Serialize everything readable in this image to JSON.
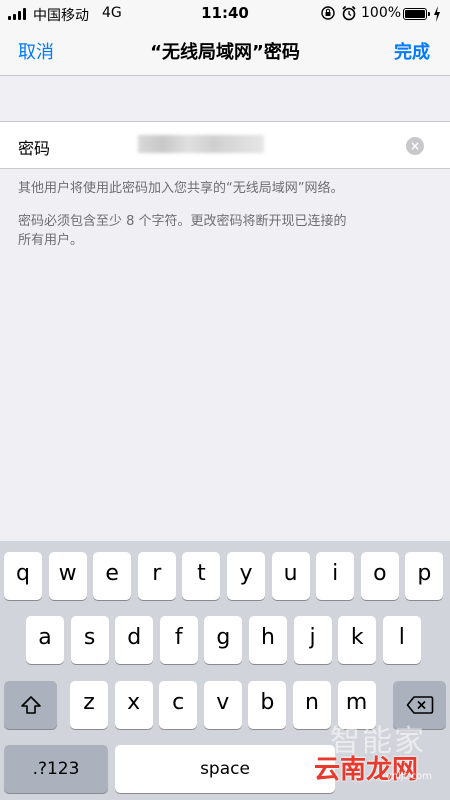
{
  "status_bar": {
    "carrier": "中国移动",
    "network": "4G",
    "time": "11:40",
    "battery_percent": "100%"
  },
  "nav": {
    "cancel_label": "取消",
    "title": "“无线局域网”密码",
    "done_label": "完成"
  },
  "form": {
    "password_label": "密码",
    "password_value": "********",
    "clear_icon": "×"
  },
  "footer": {
    "line1": "其他用户将使用此密码加入您共享的“无线局域网”网络。",
    "line2a": "密码必须包含至少 8 个字符。更改密码将断开现已连接的",
    "line2b": "所有用户。"
  },
  "keyboard": {
    "row1": [
      "q",
      "w",
      "e",
      "r",
      "t",
      "y",
      "u",
      "i",
      "o",
      "p"
    ],
    "row2": [
      "a",
      "s",
      "d",
      "f",
      "g",
      "h",
      "j",
      "k",
      "l"
    ],
    "row3": [
      "z",
      "x",
      "c",
      "v",
      "b",
      "n",
      "m"
    ],
    "mode_label": ".?123",
    "space_label": "space",
    "shift_icon": "⇧"
  },
  "watermark": {
    "top_text": "智能家",
    "main_text": "云南龙网",
    "sub_text": "ynljt.com"
  },
  "colors": {
    "accent": "#007aff",
    "background": "#efeff4",
    "keyboard": "#d1d5db"
  }
}
